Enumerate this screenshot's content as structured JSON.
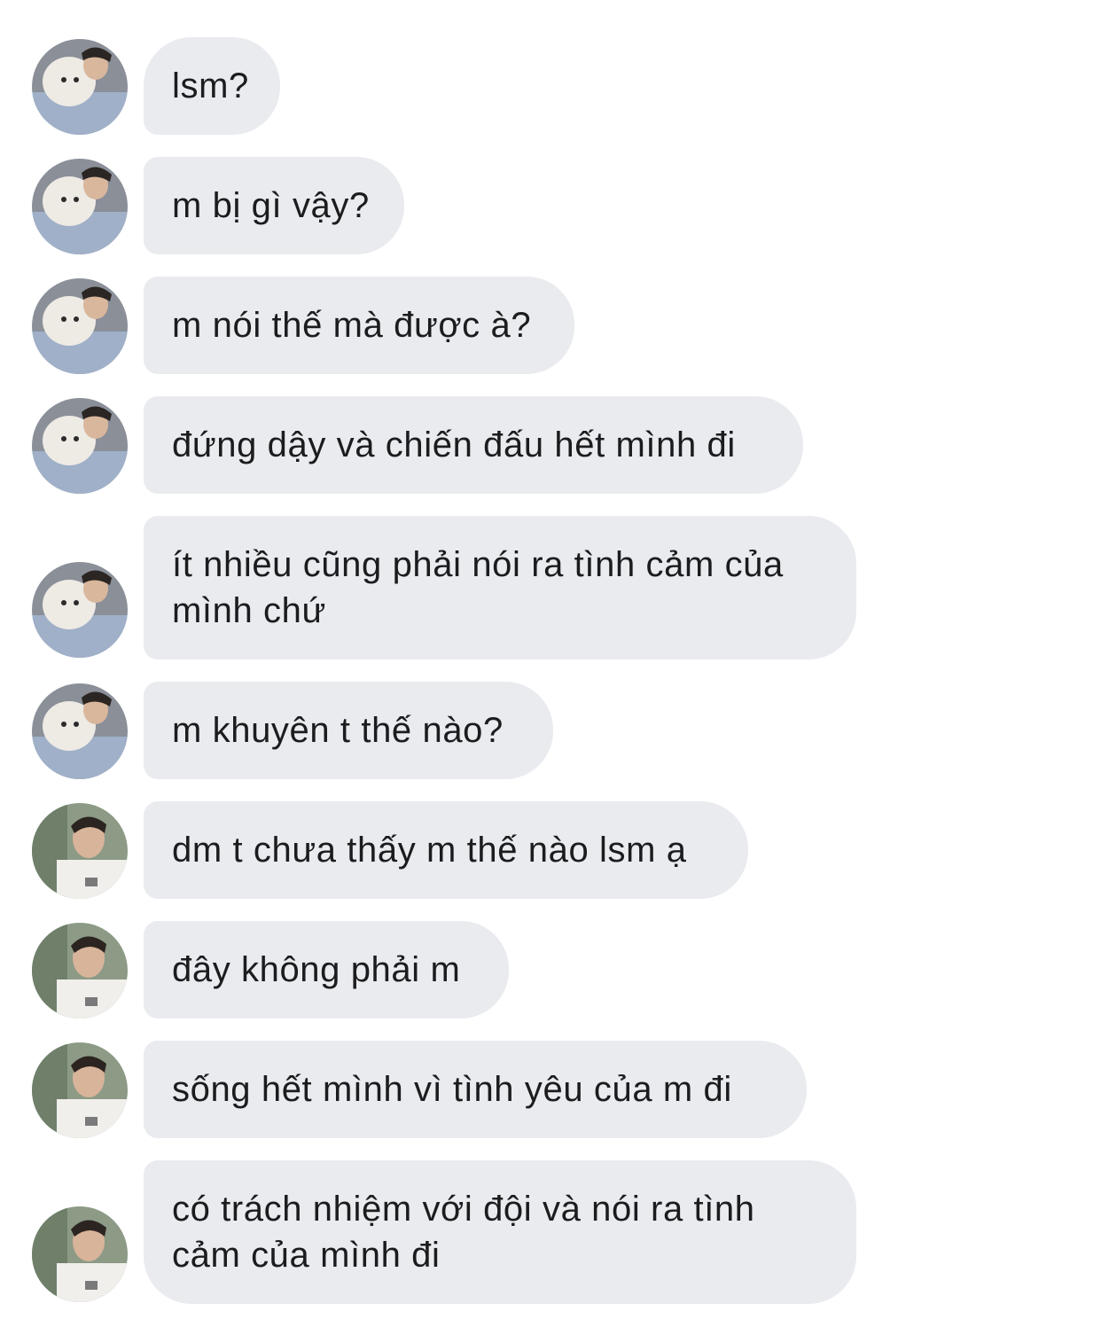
{
  "messages": [
    {
      "sender": "friend-a",
      "text": "lsm?"
    },
    {
      "sender": "friend-a",
      "text": "m bị gì vậy?"
    },
    {
      "sender": "friend-a",
      "text": "m nói thế mà được à?"
    },
    {
      "sender": "friend-a",
      "text": "đứng dậy và chiến đấu hết mình đi"
    },
    {
      "sender": "friend-a",
      "text": "ít nhiều cũng phải nói ra tình cảm của mình chứ"
    },
    {
      "sender": "friend-a",
      "text": "m khuyên t thế nào?"
    },
    {
      "sender": "friend-b",
      "text": "dm t chưa thấy m thế nào lsm ạ"
    },
    {
      "sender": "friend-b",
      "text": "đây không phải m"
    },
    {
      "sender": "friend-b",
      "text": "sống hết mình vì tình yêu của m đi"
    },
    {
      "sender": "friend-b",
      "text": "có trách nhiệm với đội và nói ra tình cảm của mình đi"
    }
  ],
  "colors": {
    "bubble": "#e9ebef",
    "text": "#1c1c1e",
    "background": "#ffffff"
  }
}
